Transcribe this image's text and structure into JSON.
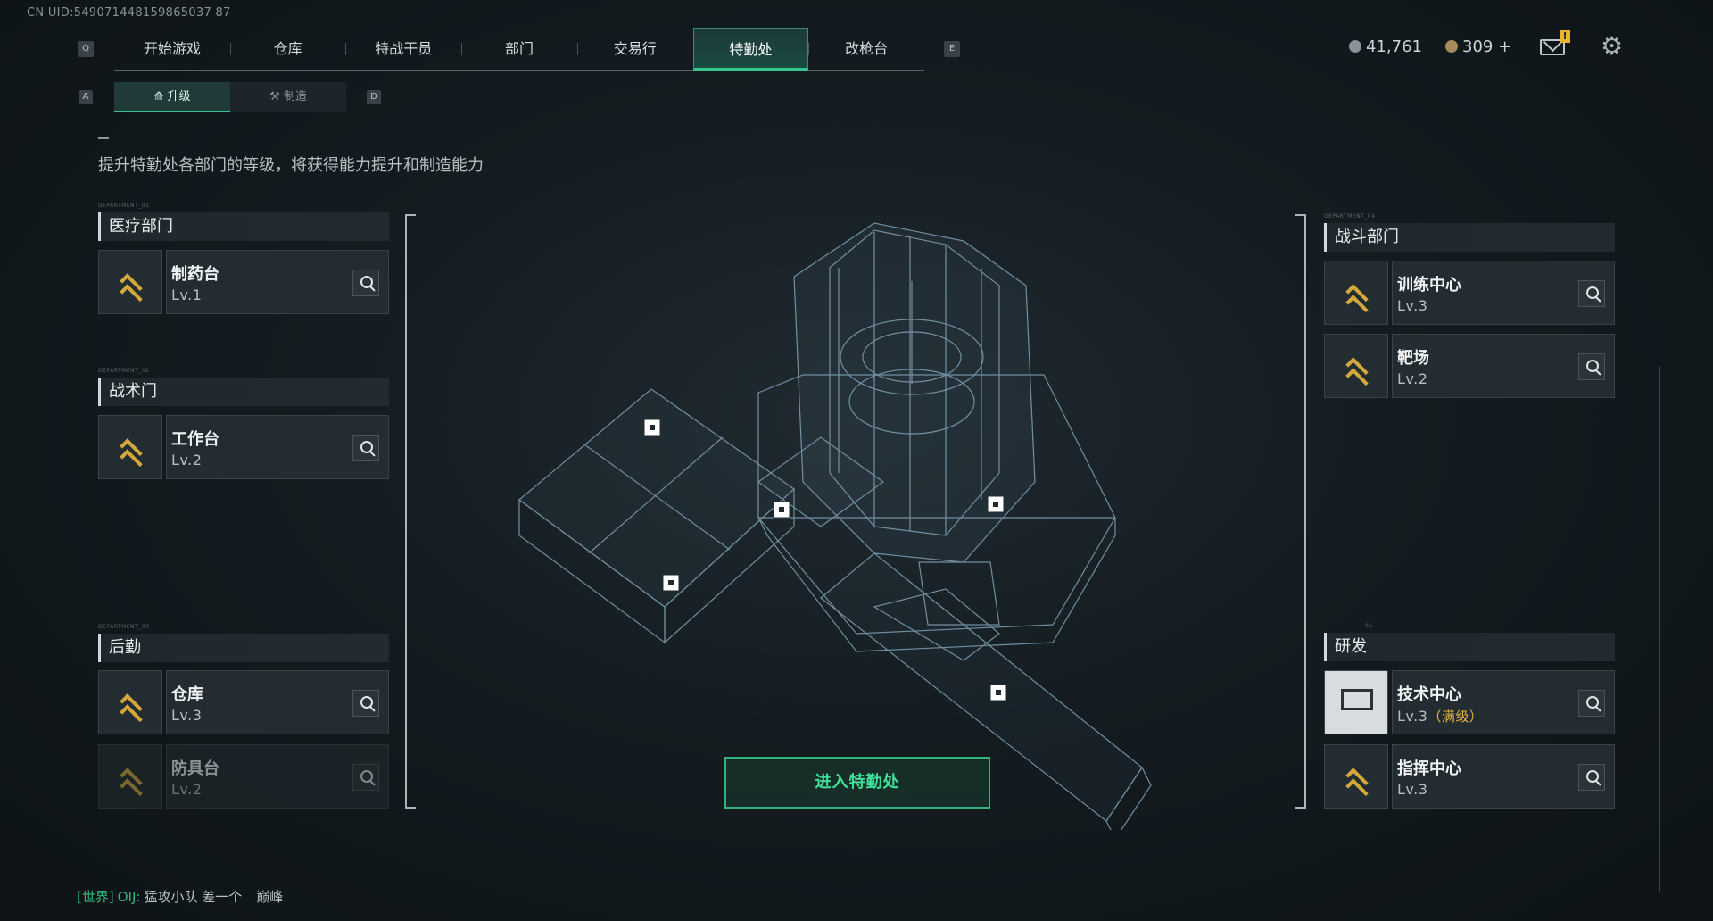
{
  "uid": "CN UID:549071448159865037 87",
  "nav": {
    "left_key": "Q",
    "right_key": "E",
    "tabs": [
      "开始游戏",
      "仓库",
      "特战干员",
      "部门",
      "交易行",
      "特勤处",
      "改枪台"
    ],
    "active": "特勤处"
  },
  "currency": {
    "coins": "41,761",
    "gems": "309 +"
  },
  "mail_badge": "!",
  "subnav": {
    "left_key": "A",
    "right_key": "D",
    "upgrade": "升级",
    "craft": "制造",
    "active": "升级"
  },
  "description": "提升特勤处各部门的等级，将获得能力提升和制造能力",
  "departments": {
    "medical": {
      "tag": "DEPARTMENT_01",
      "title": "医疗部门",
      "items": [
        {
          "name": "制药台",
          "level": "Lv.1"
        }
      ]
    },
    "tactical": {
      "tag": "DEPARTMENT_02",
      "title": "战术门",
      "items": [
        {
          "name": "工作台",
          "level": "Lv.2"
        }
      ]
    },
    "logistics": {
      "tag": "DEPARTMENT_03",
      "title": "后勤",
      "items": [
        {
          "name": "仓库",
          "level": "Lv.3"
        },
        {
          "name": "防具台",
          "level": "Lv.2"
        }
      ]
    },
    "combat": {
      "tag": "DEPARTMENT_04",
      "title": "战斗部门",
      "items": [
        {
          "name": "训练中心",
          "level": "Lv.3"
        },
        {
          "name": "靶场",
          "level": "Lv.2"
        }
      ]
    },
    "research": {
      "tag": "05",
      "title": "研发",
      "items": [
        {
          "name": "技术中心",
          "level": "Lv.3",
          "max": "（满级）"
        },
        {
          "name": "指挥中心",
          "level": "Lv.3"
        }
      ]
    }
  },
  "enter_button": "进入特勤处",
  "chat": {
    "channel": "[世界]",
    "sender": "OIJ:",
    "message": "猛攻小队 差一个",
    "tail": "巅峰"
  },
  "colors": {
    "accent_green": "#35c58d",
    "gold": "#d4a83a",
    "max_level": "#e5b53d"
  }
}
